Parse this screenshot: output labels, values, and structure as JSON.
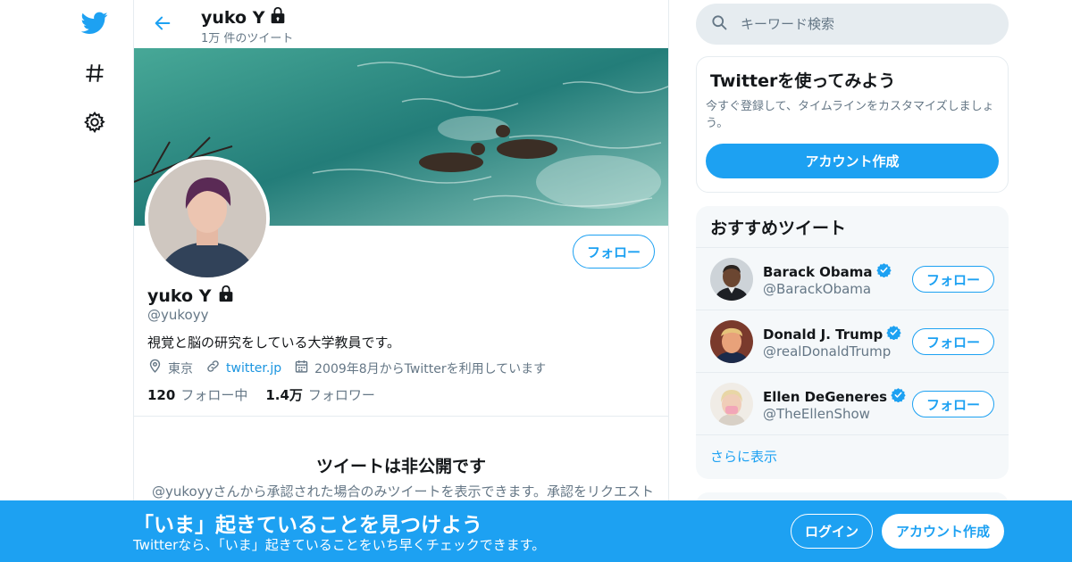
{
  "colors": {
    "accent": "#1da1f2",
    "text": "#14171a",
    "muted": "#657786",
    "border": "#e6ecf0"
  },
  "nav": {
    "icons": [
      "twitter-logo-icon",
      "hashtag-icon",
      "gear-icon"
    ]
  },
  "header": {
    "name": "yuko Y",
    "tweet_count": "1万 件のツイート"
  },
  "profile": {
    "name": "yuko Y",
    "handle": "@yukoyy",
    "bio": "視覚と脳の研究をしている大学教員です。",
    "location": "東京",
    "website": "twitter.jp",
    "joined": "2009年8月からTwitterを利用しています",
    "following_count": "120",
    "following_label": "フォロー中",
    "followers_count": "1.4万",
    "followers_label": "フォロワー",
    "follow_label": "フォロー"
  },
  "private": {
    "title": "ツイートは非公開です",
    "desc": "@yukoyyさんから承認された場合のみツイートを表示できます。承認をリクエスト"
  },
  "search": {
    "placeholder": "キーワード検索"
  },
  "signup_card": {
    "title": "Twitterを使ってみよう",
    "desc": "今すぐ登録して、タイムラインをカスタマイズしましょう。",
    "button": "アカウント作成"
  },
  "recommend": {
    "title": "おすすめツイート",
    "items": [
      {
        "name": "Barack Obama",
        "handle": "@BarackObama",
        "follow": "フォロー"
      },
      {
        "name": "Donald J. Trump",
        "handle": "@realDonaldTrump",
        "follow": "フォロー"
      },
      {
        "name": "Ellen DeGeneres",
        "handle": "@TheEllenShow",
        "follow": "フォロー"
      }
    ],
    "show_more": "さらに表示"
  },
  "bottom_bar": {
    "title": "「いま」起きていることを見つけよう",
    "subtitle": "Twitterなら、「いま」起きていることをいち早くチェックできます。",
    "login": "ログイン",
    "signup": "アカウント作成"
  }
}
